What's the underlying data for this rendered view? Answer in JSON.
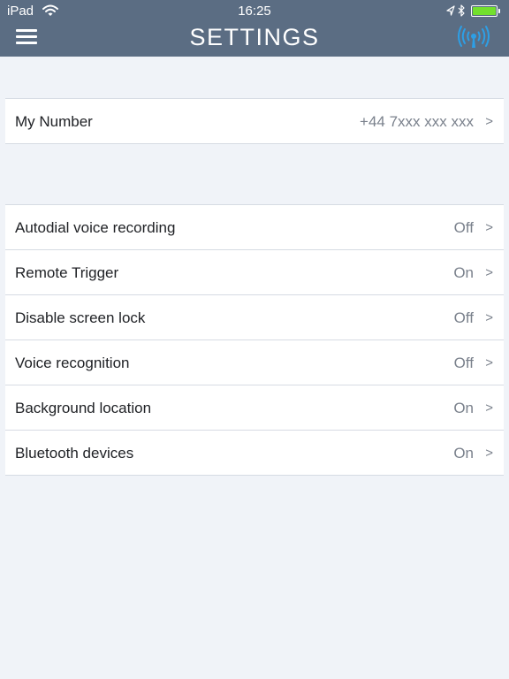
{
  "status_bar": {
    "device": "iPad",
    "time": "16:25",
    "wifi_icon": "wifi-icon",
    "location_icon": "location-arrow-icon",
    "bluetooth_icon": "bluetooth-icon",
    "battery_icon": "battery-icon",
    "battery_level": 1.0,
    "battery_color": "#72e02d"
  },
  "nav": {
    "title": "SETTINGS",
    "menu_icon": "hamburger-menu-icon",
    "right_icon": "signal-broadcast-icon",
    "bar_color": "#5b6d83",
    "accent_color": "#2d9fe6"
  },
  "my_number": {
    "label": "My Number",
    "value": "+44 7xxx xxx xxx",
    "chevron": ">"
  },
  "settings": [
    {
      "label": "Autodial voice recording",
      "value": "Off",
      "chevron": ">"
    },
    {
      "label": "Remote Trigger",
      "value": "On",
      "chevron": ">"
    },
    {
      "label": "Disable screen lock",
      "value": "Off",
      "chevron": ">"
    },
    {
      "label": "Voice recognition",
      "value": "Off",
      "chevron": ">"
    },
    {
      "label": "Background location",
      "value": "On",
      "chevron": ">"
    },
    {
      "label": "Bluetooth devices",
      "value": "On",
      "chevron": ">"
    }
  ]
}
